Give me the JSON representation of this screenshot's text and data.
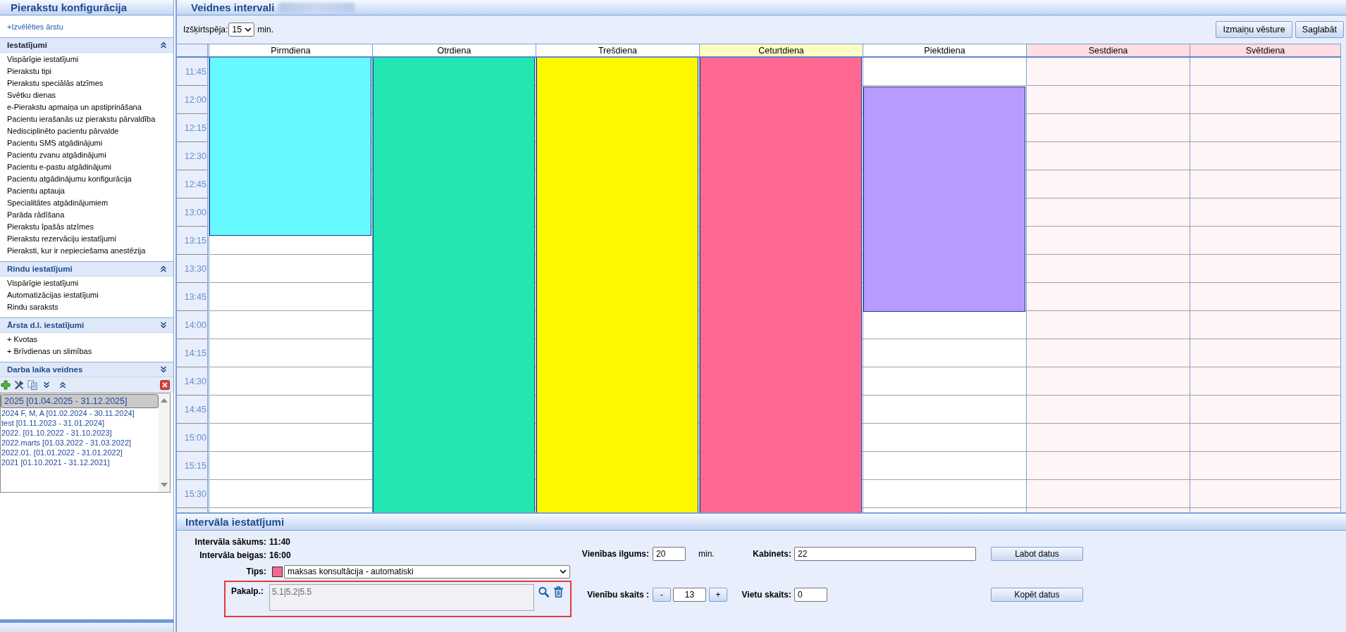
{
  "sidebar": {
    "title": "Pierakstu konfigurācija",
    "choose_doctor_link": "+Izvēlēties ārstu",
    "sections": [
      {
        "kind": "links",
        "title": "Iestatījumi",
        "expanded": true,
        "active": true,
        "items": [
          "Vispārīgie iestatījumi",
          "Pierakstu tipi",
          "Pierakstu speciālās atzīmes",
          "Svētku dienas",
          "e-Pierakstu apmaiņa un apstiprināšana",
          "Pacientu ierašanās uz pierakstu pārvaldība",
          "Nedisciplinēto pacientu pārvalde",
          "Pacientu SMS atgādinājumi",
          "Pacientu zvanu atgādinājumi",
          "Pacientu e-pastu atgādinājumi",
          "Pacientu atgādinājumu konfigurācija",
          "Pacientu aptauja",
          "Specialitātes atgādinājumiem",
          "Parāda rādīšana",
          "Pierakstu īpašās atzīmes",
          "Pierakstu rezervāciju iestatījumi",
          "Pieraksti, kur ir nepieciešama anestēzija"
        ]
      },
      {
        "kind": "links",
        "title": "Rindu iestatījumi",
        "expanded": true,
        "active": false,
        "items": [
          "Vispārīgie iestatījumi",
          "Automatizācijas iestatījumi",
          "Rindu saraksts"
        ]
      },
      {
        "kind": "links",
        "title": "Ārsta d.l. iestatījumi",
        "expanded": false,
        "active": false,
        "items": [
          "+ Kvotas",
          "+ Brīvdienas un slimības"
        ]
      },
      {
        "kind": "templates",
        "title": "Darba laika veidnes",
        "expanded": false,
        "active": false,
        "templates": [
          {
            "label": "2025 [01.04.2025 - 31.12.2025]",
            "selected": true
          },
          {
            "label": "2024 F, M, A [01.02.2024 - 30.11.2024]",
            "selected": false
          },
          {
            "label": "test [01.11.2023 - 31.01.2024]",
            "selected": false
          },
          {
            "label": "2022. [01.10.2022 - 31.10.2023]",
            "selected": false
          },
          {
            "label": "2022.marts [01.03.2022 - 31.03.2022]",
            "selected": false
          },
          {
            "label": "2022.01. [01.01.2022 - 31.01.2022]",
            "selected": false
          },
          {
            "label": "2021 [01.10.2021 - 31.12.2021]",
            "selected": false
          }
        ]
      }
    ]
  },
  "intervals_view": {
    "title": "Veidnes intervali",
    "resolution": {
      "label": "Izšķirtspēja:",
      "value": "15",
      "unit": "min."
    },
    "buttons": [
      "Izmaiņu vēsture",
      "Saglabāt"
    ],
    "calendar": {
      "times": [
        "11:45",
        "12:00",
        "12:15",
        "12:30",
        "12:45",
        "13:00",
        "13:15",
        "13:30",
        "13:45",
        "14:00",
        "14:15",
        "14:30",
        "14:45",
        "15:00",
        "15:15",
        "15:30"
      ],
      "days": [
        {
          "name": "Pirmdiena",
          "today": false,
          "weekend": false,
          "blocks": [
            {
              "color": "#66faff"
            }
          ]
        },
        {
          "name": "Otrdiena",
          "today": false,
          "weekend": false,
          "blocks": [
            {
              "color": "#22e6b0"
            }
          ]
        },
        {
          "name": "Trešdiena",
          "today": false,
          "weekend": false,
          "blocks": [
            {
              "color": "#fff700"
            }
          ]
        },
        {
          "name": "Ceturtdiena",
          "today": true,
          "weekend": false,
          "blocks": [
            {
              "color": "#ff6991"
            }
          ]
        },
        {
          "name": "Piektdiena",
          "today": false,
          "weekend": false,
          "blocks": [
            {
              "color": "#b99bff"
            }
          ]
        },
        {
          "name": "Sestdiena",
          "today": false,
          "weekend": true
        },
        {
          "name": "Svētdiena",
          "today": false,
          "weekend": true
        }
      ]
    }
  },
  "interval_settings": {
    "title": "Intervāla iestatījumi",
    "start": {
      "label": "Intervāla sākums:",
      "value": "11:40"
    },
    "end": {
      "label": "Intervāla beigas:",
      "value": "16:00"
    },
    "type": {
      "label": "Tips:",
      "color": "#f4698f",
      "value": "maksas konsultācija - automatiski"
    },
    "services": {
      "label": "Pakalp.:",
      "value": "5.1|5.2|5.5",
      "highlighted": true
    },
    "unit_length": {
      "label": "Vienības ilgums:",
      "value": "20",
      "unit": "min."
    },
    "room": {
      "label": "Kabinets:",
      "value": "22"
    },
    "unit_count": {
      "label": "Vienību skaits :",
      "decrement": "-",
      "value": "13",
      "increment": "+"
    },
    "seat_count": {
      "label": "Vietu skaits:",
      "value": "0"
    },
    "buttons": [
      "Labot datus",
      "Kopēt datus"
    ]
  }
}
